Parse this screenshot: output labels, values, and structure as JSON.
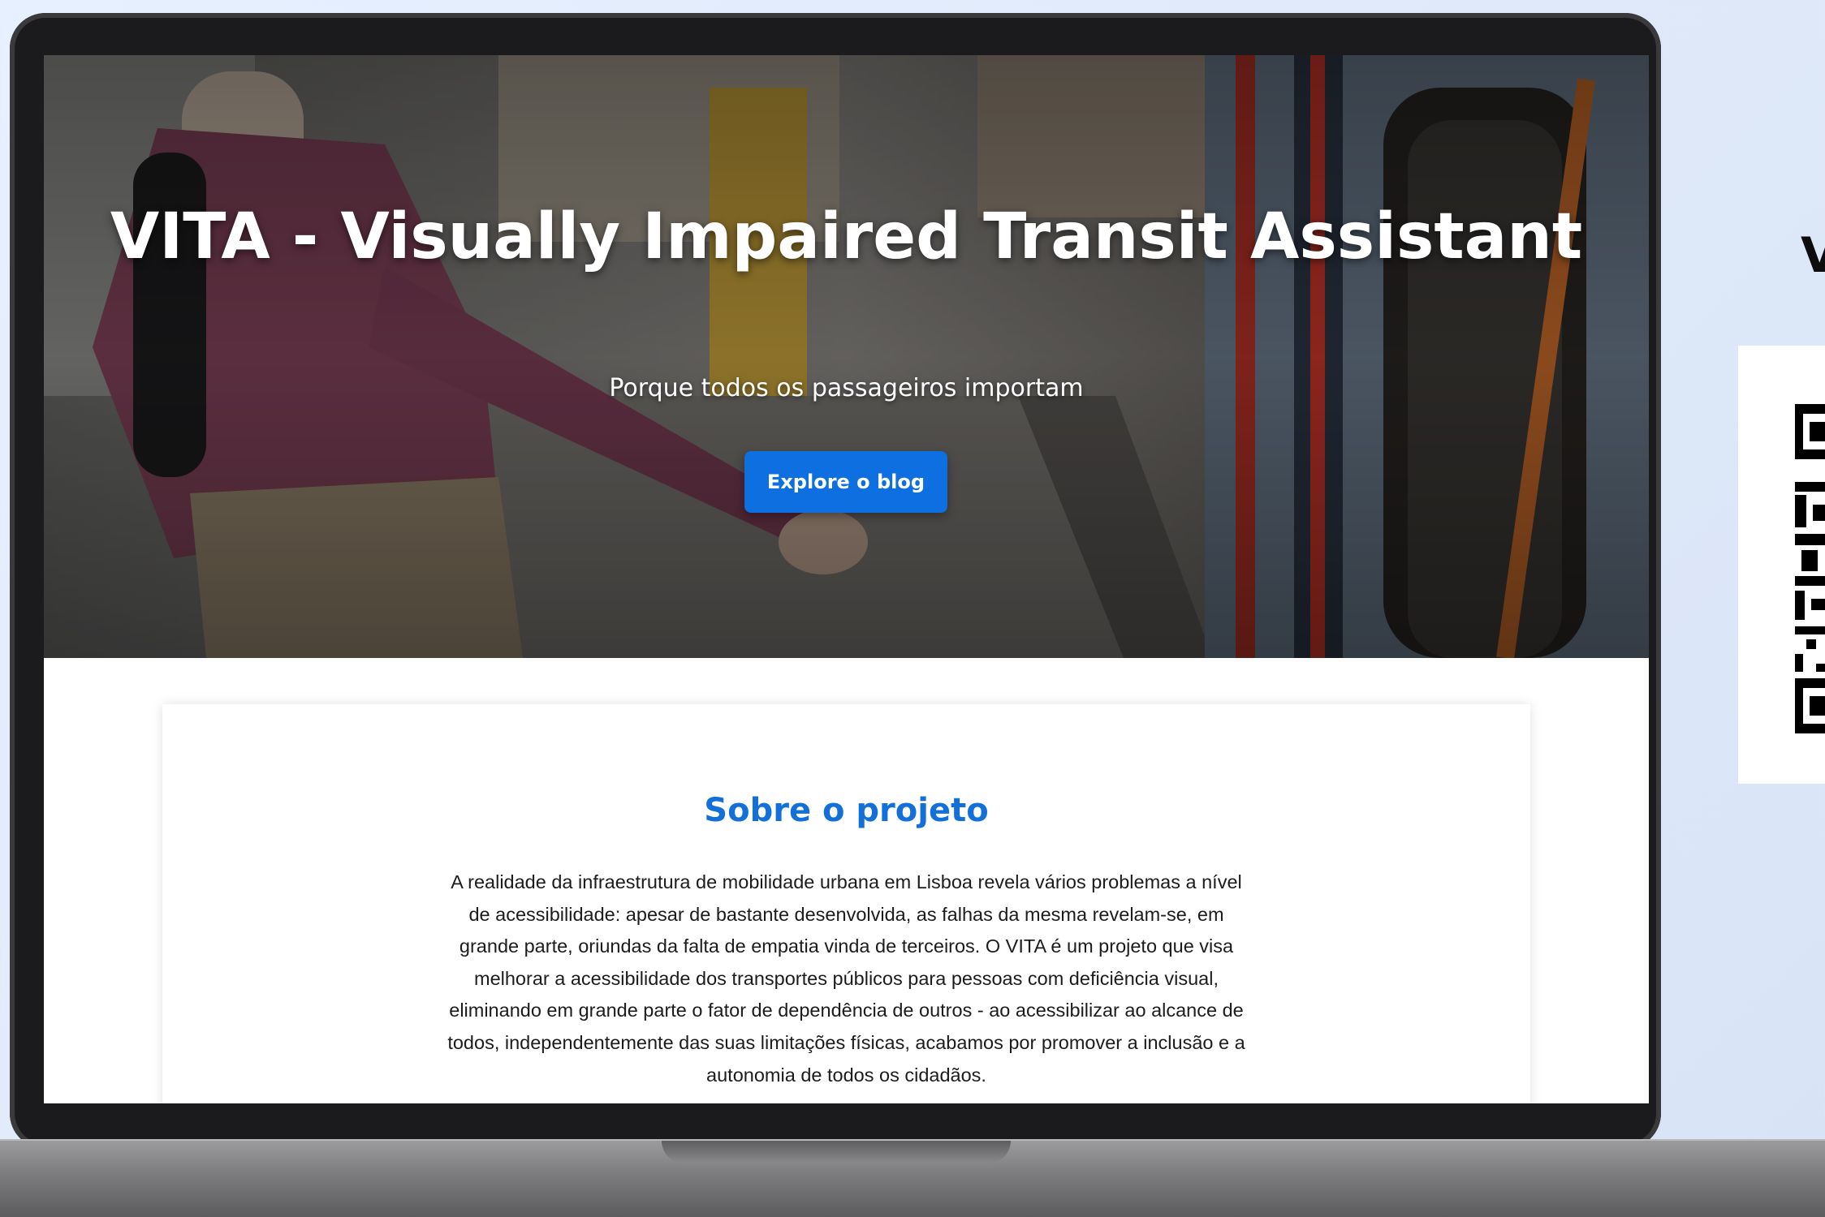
{
  "hero": {
    "title": "VITA - Visually Impaired Transit Assistant",
    "subtitle": "Porque todos os passageiros importam",
    "cta_label": "Explore o blog"
  },
  "about": {
    "title": "Sobre o projeto",
    "body": "A realidade da infraestrutura de mobilidade urbana em Lisboa revela vários problemas a nível de acessibilidade: apesar de bastante desenvolvida, as falhas da mesma revelam-se, em grande parte, oriundas da falta de empatia vinda de terceiros. O VITA é um projeto que visa melhorar a acessibilidade dos transportes públicos para pessoas com deficiência visual, eliminando em grande parte o fator de dependência de outros - ao acessibilizar ao alcance de todos, independentemente das suas limitações físicas, acabamos por promover a inclusão e a autonomia de todos os cidadãos."
  },
  "side": {
    "heading_partial": "V"
  },
  "colors": {
    "accent": "#0d6fe0",
    "title_blue": "#1370d8",
    "page_background": "#e3edfb",
    "laptop_frame": "#1b1b1d"
  }
}
